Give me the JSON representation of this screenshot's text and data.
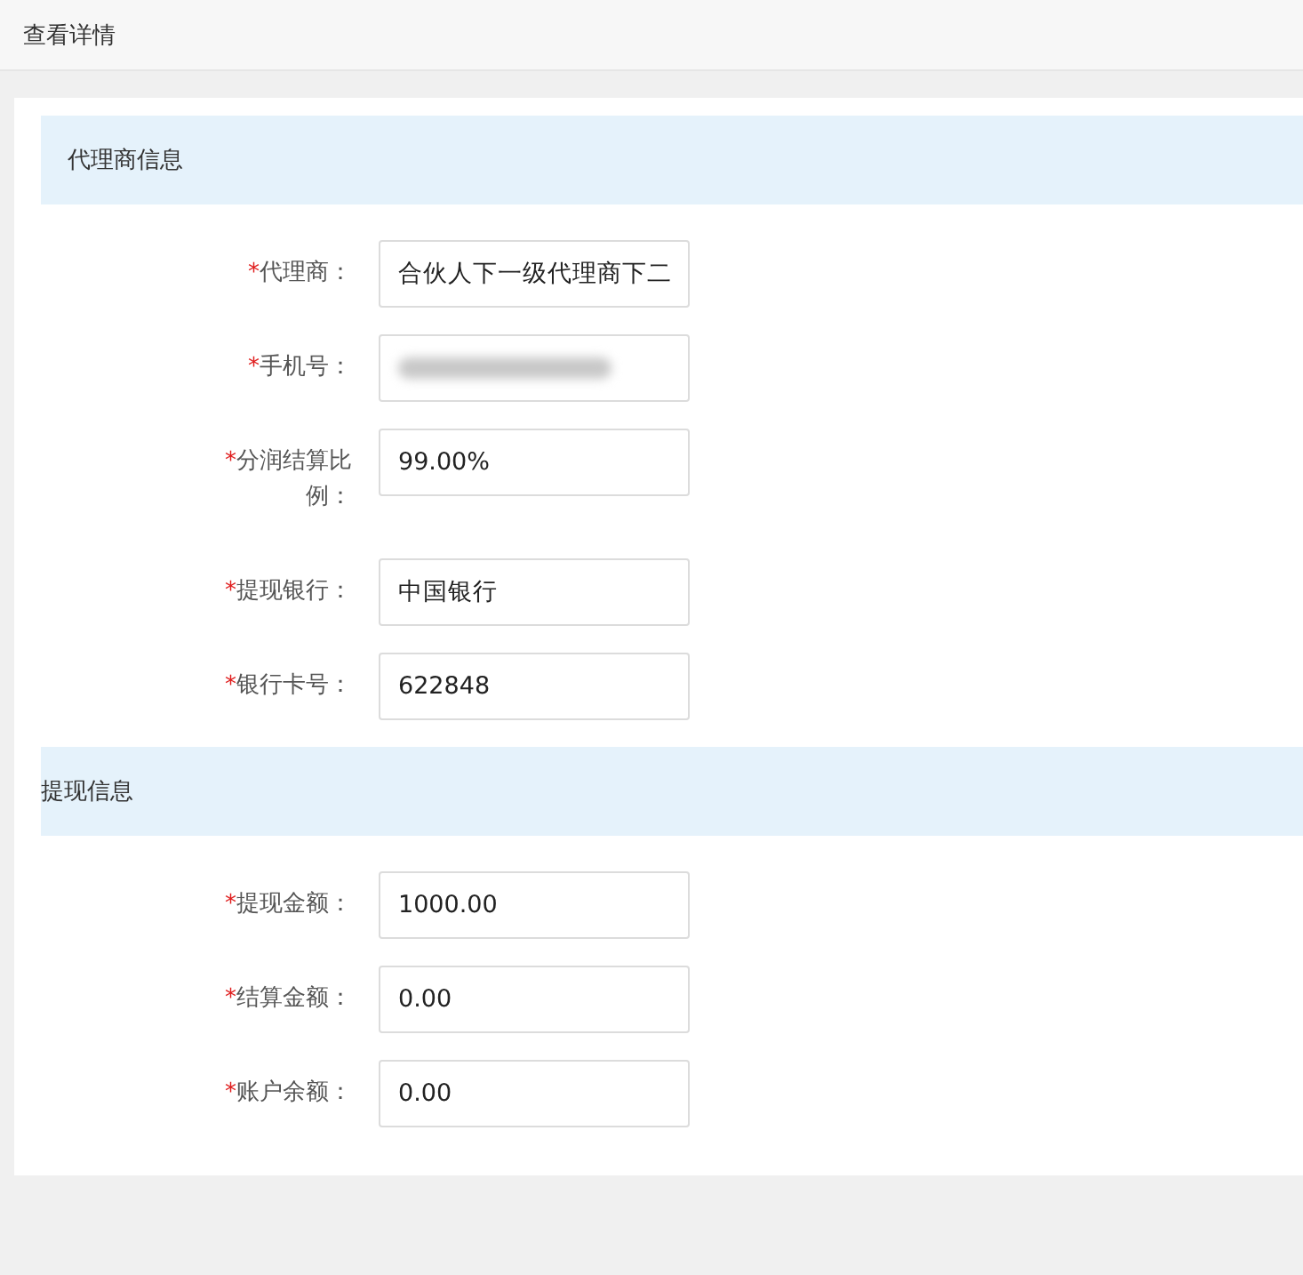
{
  "header": {
    "title": "查看详情"
  },
  "sections": [
    {
      "title": "代理商信息",
      "indented": true,
      "fields": [
        {
          "label": "代理商：",
          "required": "*",
          "value": "合伙人下一级代理商下二"
        },
        {
          "label": "手机号：",
          "required": "*",
          "value_hidden": true
        },
        {
          "label": "分润结算比例：",
          "required": "*",
          "value": "99.00%"
        },
        {
          "label": "提现银行：",
          "required": "*",
          "value": "中国银行"
        },
        {
          "label": "银行卡号：",
          "required": "*",
          "value": "622848"
        }
      ]
    },
    {
      "title": "提现信息",
      "indented": false,
      "fields": [
        {
          "label": "提现金额：",
          "required": "*",
          "value": "1000.00"
        },
        {
          "label": "结算金额：",
          "required": "*",
          "value": "0.00"
        },
        {
          "label": "账户余额：",
          "required": "*",
          "value": "0.00"
        }
      ]
    }
  ]
}
